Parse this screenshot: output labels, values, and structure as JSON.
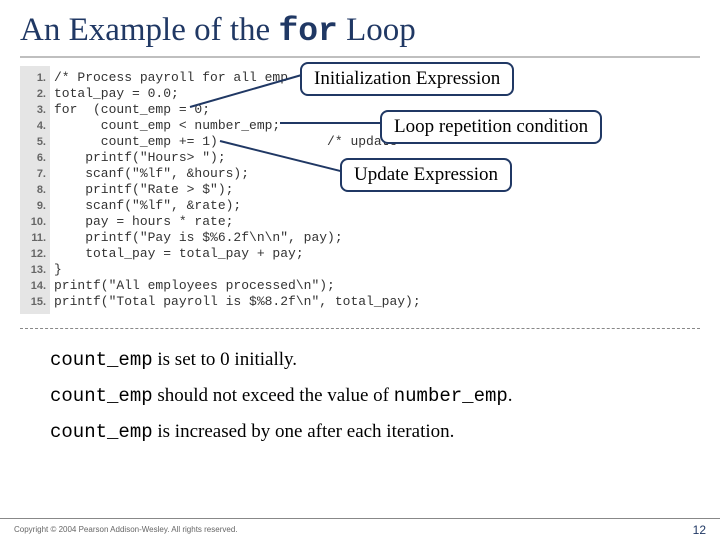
{
  "title": {
    "pre": "An Example of the ",
    "code": "for",
    "post": " Loop"
  },
  "callouts": {
    "init": "Initialization Expression",
    "cond": "Loop repetition condition",
    "update": "Update Expression"
  },
  "code": {
    "line_numbers": "1.\n2.\n3.\n4.\n5.\n6.\n7.\n8.\n9.\n10.\n11.\n12.\n13.\n14.\n15.",
    "l1": "/* Process payroll for all emp",
    "l2": "total_pay = 0.0;",
    "l3": "for  (count_emp = 0;",
    "l4a": "      count_emp < number_emp;",
    "l5a": "      count_emp += 1)  ",
    "l5b": "            /* update",
    "l6": "    printf(\"Hours> \");",
    "l7": "    scanf(\"%lf\", &hours);",
    "l8": "    printf(\"Rate > $\");",
    "l9": "    scanf(\"%lf\", &rate);",
    "l10": "    pay = hours * rate;",
    "l11": "    printf(\"Pay is $%6.2f\\n\\n\", pay);",
    "l12": "    total_pay = total_pay + pay;",
    "l13": "}",
    "l14": "printf(\"All employees processed\\n\");",
    "l15": "printf(\"Total payroll is $%8.2f\\n\", total_pay);"
  },
  "notes": {
    "n1a": "count_emp",
    "n1b": " is set to 0 initially.",
    "n2a": "count_emp",
    "n2b": " should not exceed the value of ",
    "n2c": "number_emp",
    "n2d": ".",
    "n3a": "count_emp",
    "n3b": " is increased by one after each iteration."
  },
  "footer": {
    "copyright": "Copyright © 2004 Pearson Addison-Wesley. All rights reserved.",
    "page": "12"
  }
}
